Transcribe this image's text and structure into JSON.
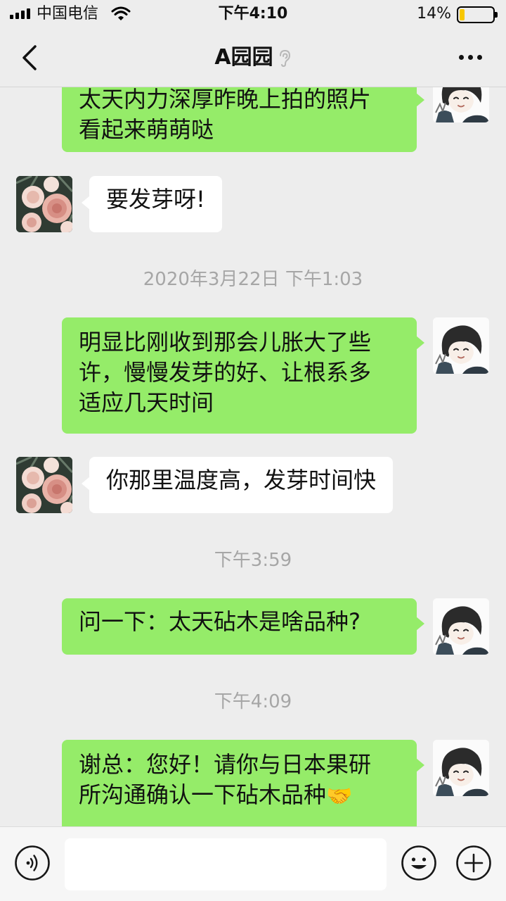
{
  "status_bar": {
    "carrier": "中国电信",
    "time": "下午4:10",
    "battery_percent_text": "14%",
    "battery_level": 0.14,
    "battery_color": "#f7c700"
  },
  "nav": {
    "title": "A园园",
    "back_icon": "chevron-left-icon",
    "more_icon": "more-dots-icon",
    "ear_icon": "ear-icon"
  },
  "messages": [
    {
      "side": "out",
      "lines": [
        "太天内力深厚昨晚上拍的照片",
        "看起来萌萌哒"
      ]
    },
    {
      "side": "in",
      "text": "要发芽呀!"
    },
    {
      "type": "timestamp",
      "text": "2020年3月22日 下午1:03"
    },
    {
      "side": "out",
      "lines": [
        "明显比刚收到那会儿胀大了些",
        "许，慢慢发芽的好、让根系多",
        "适应几天时间"
      ]
    },
    {
      "side": "in",
      "text": "你那里温度高，发芽时间快"
    },
    {
      "type": "timestamp",
      "text": "下午3:59"
    },
    {
      "side": "out",
      "text": "问一下：太天砧木是啥品种?"
    },
    {
      "type": "timestamp",
      "text": "下午4:09"
    },
    {
      "side": "out",
      "lines": [
        "谢总：您好！请你与日本果研",
        "所沟通确认一下砧木品种"
      ],
      "emoji": "🤝"
    }
  ],
  "input_bar": {
    "voice_icon": "voice-icon",
    "emoji_icon": "emoji-icon",
    "plus_icon": "plus-icon",
    "input_value": "",
    "input_placeholder": ""
  },
  "colors": {
    "background": "#ededed",
    "outgoing_bubble": "#95ec69",
    "incoming_bubble": "#ffffff",
    "timestamp_text": "#a6a6a6"
  }
}
